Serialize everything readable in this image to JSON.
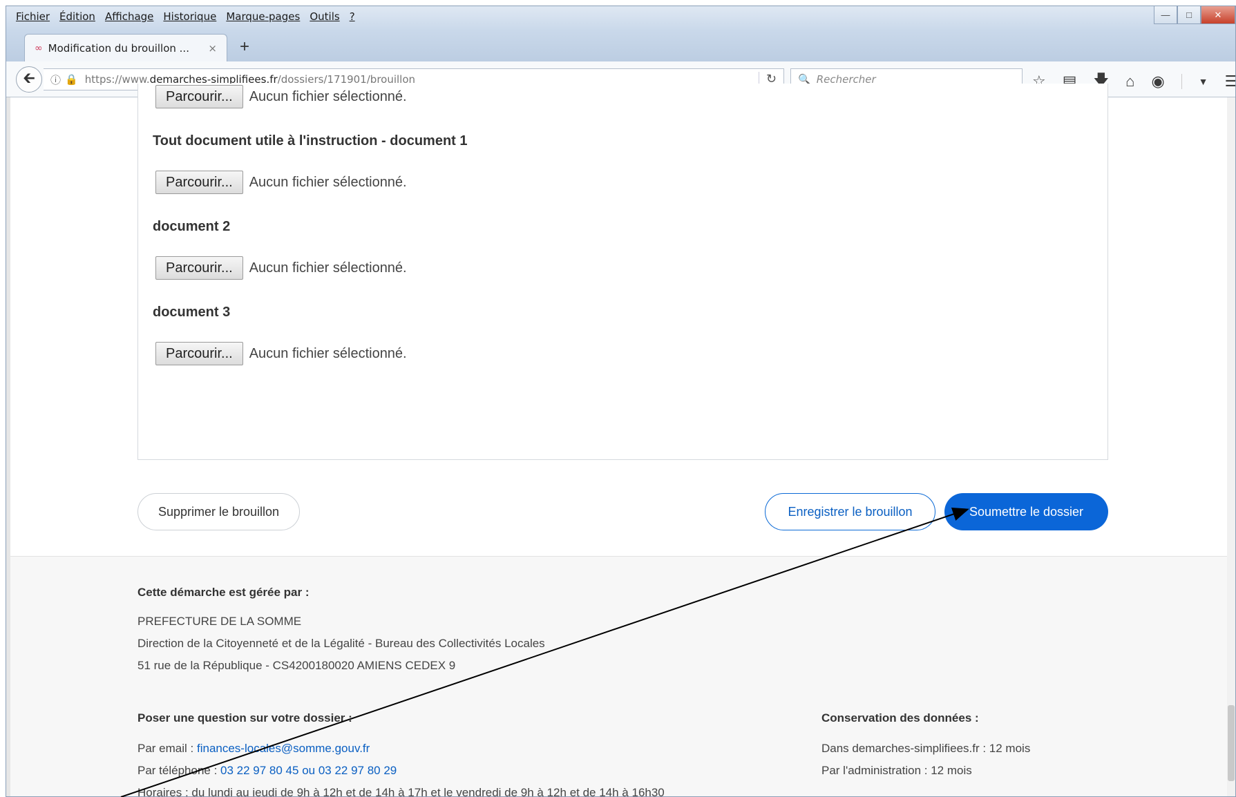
{
  "menu": [
    "Fichier",
    "Édition",
    "Affichage",
    "Historique",
    "Marque-pages",
    "Outils",
    "?"
  ],
  "tab": {
    "title": "Modification du brouillon ...",
    "close": "×",
    "new_tab": "+"
  },
  "address": {
    "prefix": "https://www.",
    "domain": "demarches-simplifiees.fr",
    "path": "/dossiers/171901/brouillon"
  },
  "search": {
    "placeholder": "Rechercher"
  },
  "form": {
    "top_file": {
      "button": "Parcourir...",
      "status": "Aucun fichier sélectionné."
    },
    "fields": [
      {
        "label": "Tout document utile à l'instruction - document 1",
        "button": "Parcourir...",
        "status": "Aucun fichier sélectionné."
      },
      {
        "label": "document 2",
        "button": "Parcourir...",
        "status": "Aucun fichier sélectionné."
      },
      {
        "label": "document 3",
        "button": "Parcourir...",
        "status": "Aucun fichier sélectionné."
      }
    ]
  },
  "actions": {
    "delete": "Supprimer le brouillon",
    "save": "Enregistrer le brouillon",
    "submit": "Soumettre le dossier"
  },
  "footer": {
    "managed_title": "Cette démarche est gérée par :",
    "org_lines": [
      "PREFECTURE DE LA SOMME",
      "Direction de la Citoyenneté et de la Légalité - Bureau des Collectivités Locales",
      "51 rue de la République - CS4200180020 AMIENS CEDEX 9"
    ],
    "question_title": "Poser une question sur votre dossier :",
    "email_label": "Par email : ",
    "email": "finances-locales@somme.gouv.fr",
    "phone_label": "Par téléphone : ",
    "phone": "03 22 97 80 45 ou 03 22 97 80 29",
    "hours": "Horaires : du lundi au jeudi de 9h à 12h et de 14h à 17h et le vendredi de 9h à 12h et de 14h à 16h30",
    "retention_title": "Conservation des données :",
    "retention_lines": [
      "Dans demarches-simplifiees.fr : 12 mois",
      "Par l'administration : 12 mois"
    ]
  },
  "colors": {
    "primary": "#0b66d8",
    "link": "#0a5fc2"
  },
  "icons": [
    "back-arrow-icon",
    "info-icon",
    "lock-icon",
    "reload-icon",
    "search-icon",
    "star-icon",
    "reading-list-icon",
    "download-icon",
    "home-icon",
    "extension-icon",
    "dropdown-icon",
    "hamburger-menu-icon"
  ]
}
